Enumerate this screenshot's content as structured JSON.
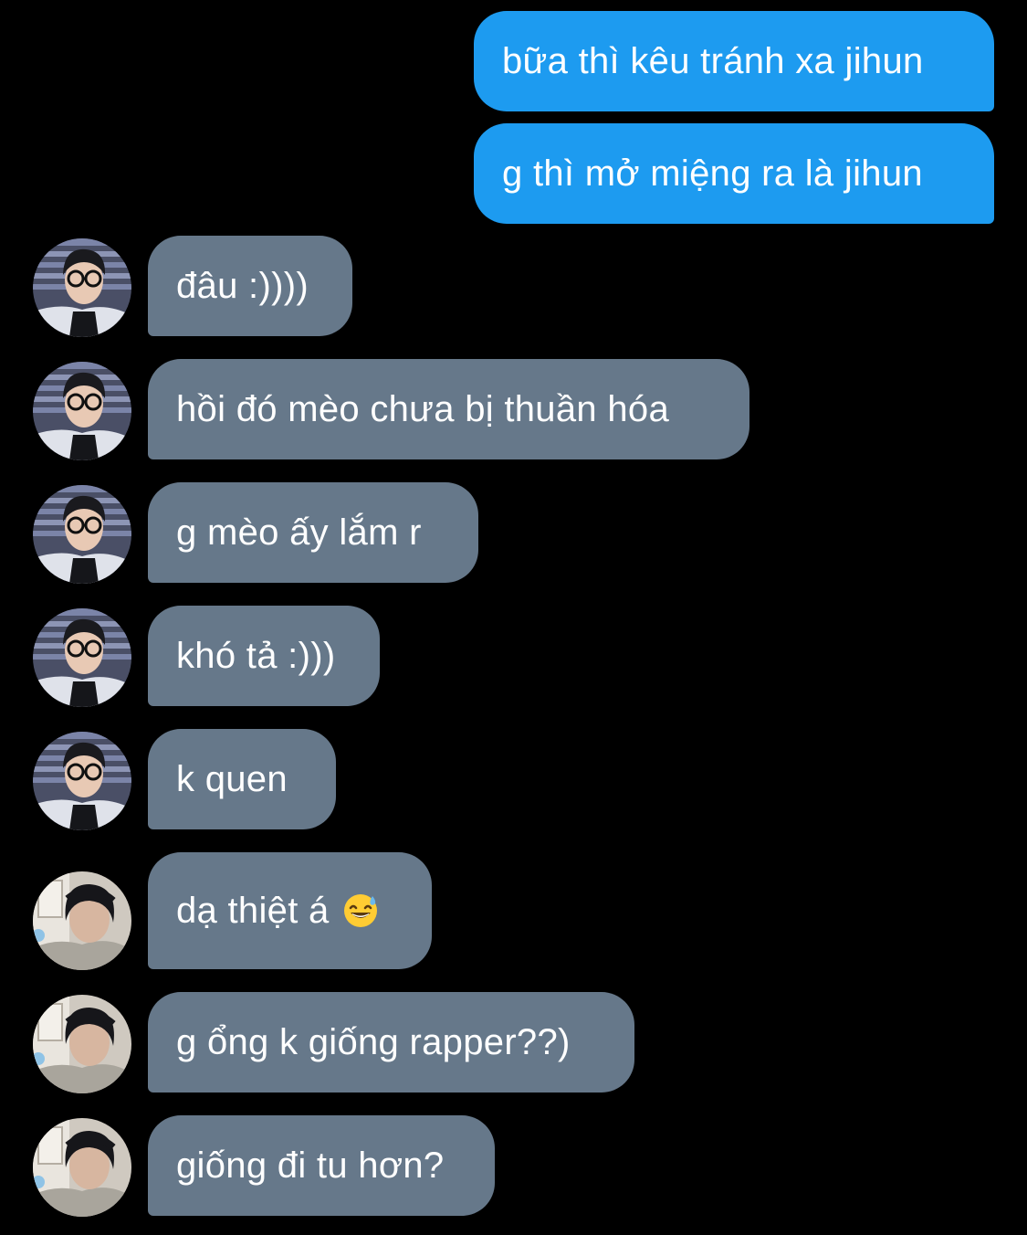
{
  "messages": [
    {
      "side": "sent",
      "text": "bữa thì kêu tránh xa jihun"
    },
    {
      "side": "sent",
      "text": "g thì mở miệng ra là jihun"
    },
    {
      "side": "received",
      "avatar": "avatar-a",
      "text": "đâu :))))"
    },
    {
      "side": "received",
      "avatar": "avatar-a",
      "text": "hồi đó mèo chưa bị thuần hóa"
    },
    {
      "side": "received",
      "avatar": "avatar-a",
      "text": "g mèo ấy lắm r"
    },
    {
      "side": "received",
      "avatar": "avatar-a",
      "text": "khó tả :)))"
    },
    {
      "side": "received",
      "avatar": "avatar-a",
      "text": "k quen"
    },
    {
      "side": "received",
      "avatar": "avatar-b",
      "text": "dạ thiệt á",
      "emoji": "grinning-sweat-emoji"
    },
    {
      "side": "received",
      "avatar": "avatar-b",
      "text": "g ổng k giống rapper??)"
    },
    {
      "side": "received",
      "avatar": "avatar-b",
      "text": "giống đi tu hơn?"
    }
  ],
  "colors": {
    "background": "#000000",
    "sent_bubble": "#1d9bf0",
    "received_bubble": "#66788a",
    "text": "#ffffff"
  }
}
